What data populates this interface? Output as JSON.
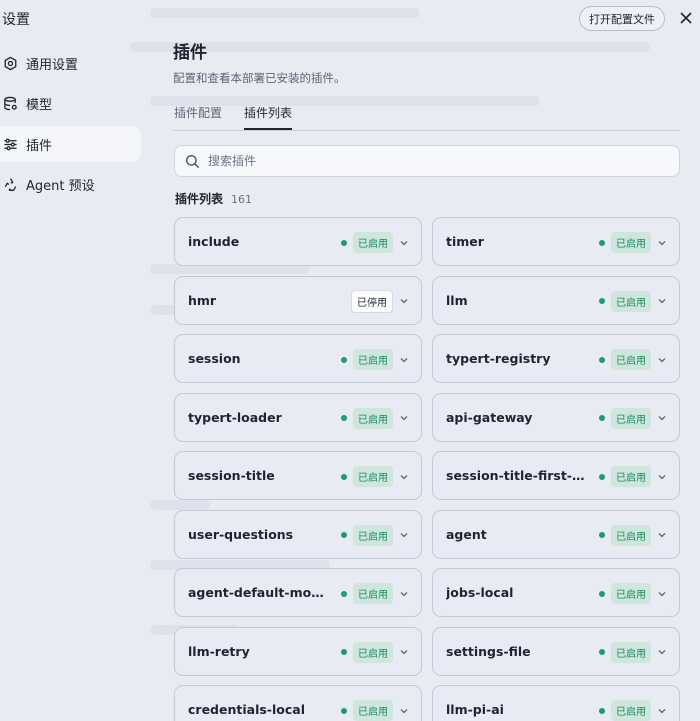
{
  "sidebar": {
    "title": "设置",
    "items": [
      {
        "label": "通用设置",
        "icon": "gear-icon"
      },
      {
        "label": "模型",
        "icon": "database-icon"
      },
      {
        "label": "插件",
        "icon": "sliders-icon"
      },
      {
        "label": "Agent 预设",
        "icon": "recycle-icon"
      }
    ],
    "active_index": 2
  },
  "header": {
    "open_config_label": "打开配置文件",
    "close_icon": "close-icon"
  },
  "main": {
    "title": "插件",
    "subtitle": "配置和查看本部署已安装的插件。",
    "tabs": [
      {
        "label": "插件配置"
      },
      {
        "label": "插件列表"
      }
    ],
    "active_tab": 1,
    "search": {
      "placeholder": "搜索插件",
      "value": ""
    },
    "list_label": "插件列表",
    "list_count": "161"
  },
  "plugins": [
    {
      "name": "include",
      "status": "已启用",
      "enabled": true
    },
    {
      "name": "timer",
      "status": "已启用",
      "enabled": true
    },
    {
      "name": "hmr",
      "status": "已停用",
      "enabled": false
    },
    {
      "name": "llm",
      "status": "已启用",
      "enabled": true
    },
    {
      "name": "session",
      "status": "已启用",
      "enabled": true
    },
    {
      "name": "typert-registry",
      "status": "已启用",
      "enabled": true
    },
    {
      "name": "typert-loader",
      "status": "已启用",
      "enabled": true
    },
    {
      "name": "api-gateway",
      "status": "已启用",
      "enabled": true
    },
    {
      "name": "session-title",
      "status": "已启用",
      "enabled": true
    },
    {
      "name": "session-title-first-pro...",
      "status": "已启用",
      "enabled": true
    },
    {
      "name": "user-questions",
      "status": "已启用",
      "enabled": true
    },
    {
      "name": "agent",
      "status": "已启用",
      "enabled": true
    },
    {
      "name": "agent-default-model",
      "status": "已启用",
      "enabled": true
    },
    {
      "name": "jobs-local",
      "status": "已启用",
      "enabled": true
    },
    {
      "name": "llm-retry",
      "status": "已启用",
      "enabled": true
    },
    {
      "name": "settings-file",
      "status": "已启用",
      "enabled": true
    },
    {
      "name": "credentials-local",
      "status": "已启用",
      "enabled": true
    },
    {
      "name": "llm-pi-ai",
      "status": "已启用",
      "enabled": true
    }
  ],
  "colors": {
    "enabled_dot": "#1a9b72",
    "enabled_badge_bg": "#cfe6dc",
    "enabled_badge_text": "#1a8a66",
    "background": "#e9ebf3"
  }
}
